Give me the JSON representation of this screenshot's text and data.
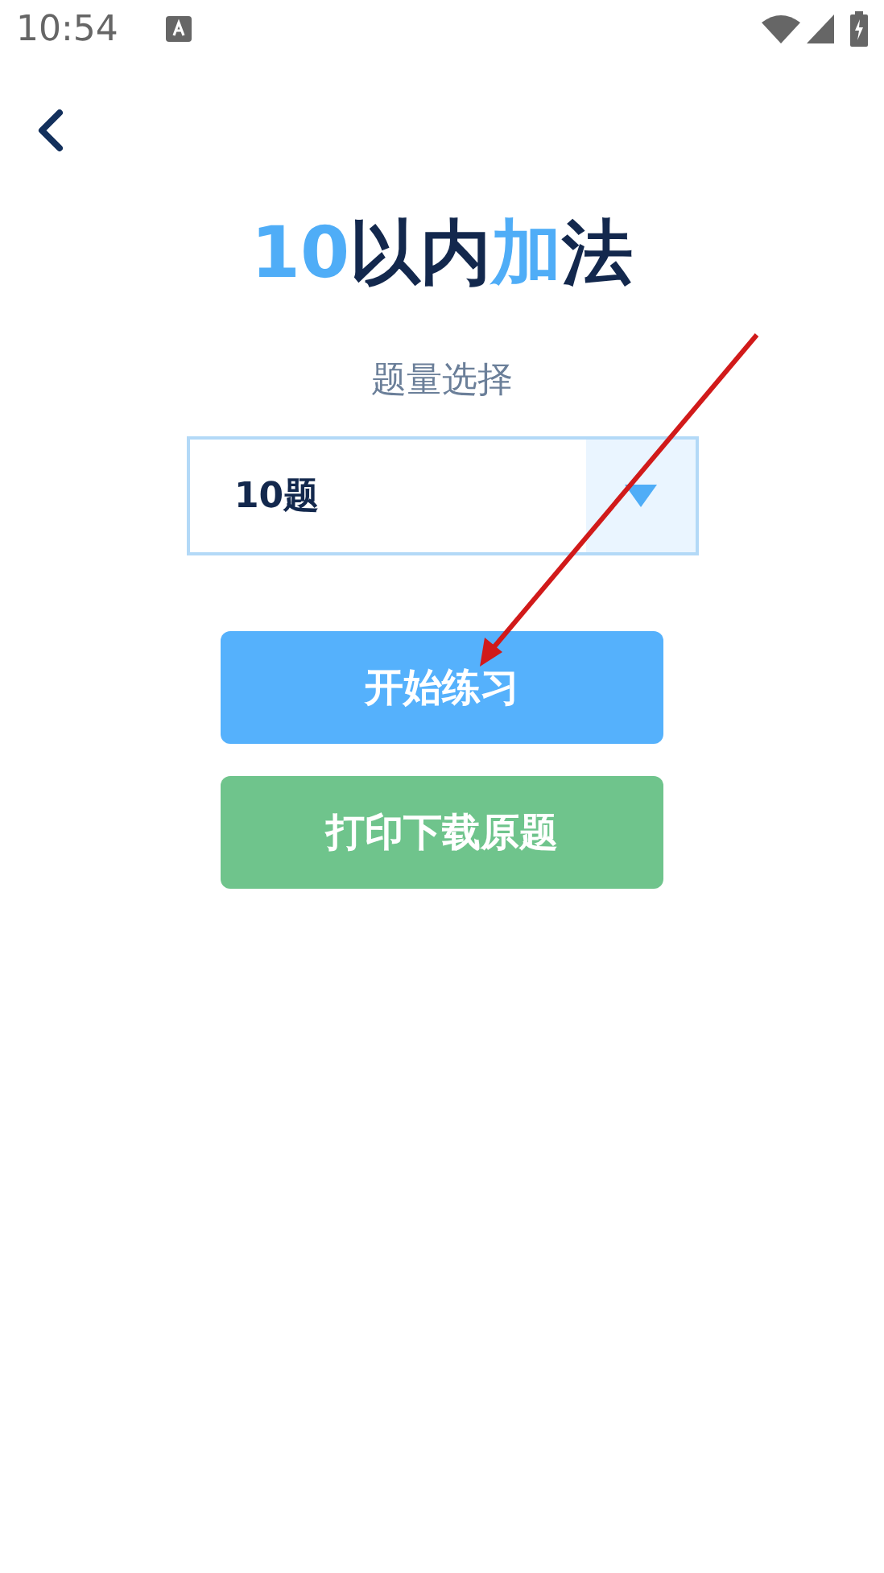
{
  "status_bar": {
    "time": "10:54"
  },
  "title": {
    "parts": [
      {
        "text": "10",
        "highlight": true
      },
      {
        "text": "以内",
        "highlight": false
      },
      {
        "text": "加",
        "highlight": true
      },
      {
        "text": "法",
        "highlight": false
      }
    ]
  },
  "quantity": {
    "label": "题量选择",
    "value": "10题"
  },
  "buttons": [
    {
      "label": "开始练习",
      "kind": "primary"
    },
    {
      "label": "打印下载原题",
      "kind": "secondary"
    }
  ]
}
